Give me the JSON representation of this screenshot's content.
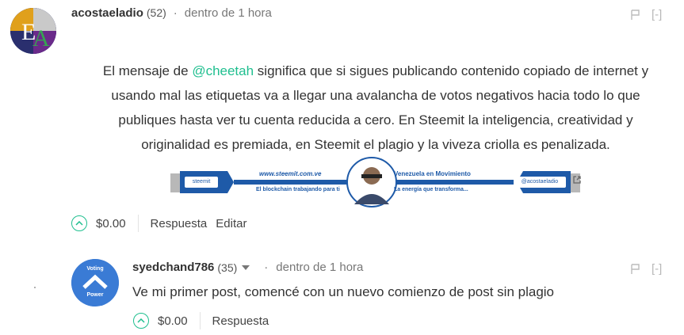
{
  "comment1": {
    "author": "acostaeladio",
    "reputation": "(52)",
    "separator": "·",
    "time": "dentro de 1 hora",
    "collapse_label": "[-]",
    "body": {
      "line1_pre": "El mensaje de ",
      "mention": "@cheetah",
      "line1_post": " significa que si sigues publicando contenido copiado de internet y",
      "line2": "usando mal las etiquetas va a llegar una avalancha de votos negativos hacia todo lo que",
      "line3": "publiques hasta ver tu cuenta reducida a cero. En Steemit la inteligencia, creatividad y",
      "line4": "originalidad es premiada, en Steemit el plagio y la viveza criolla es penalizada."
    },
    "banner": {
      "left_tag": "steemit",
      "url": "www.steemit.com.ve",
      "tagline_left": "El blockchain trabajando para ti",
      "title_right": "Venezuela en Movimiento",
      "tagline_right": "La energía que transforma...",
      "right_tag": "@acostaeladio"
    },
    "payout": "$0.00",
    "reply_label": "Respuesta",
    "edit_label": "Editar"
  },
  "comment2": {
    "author": "syedchand786",
    "reputation": "(35)",
    "separator": "·",
    "time": "dentro de 1 hora",
    "collapse_label": "[-]",
    "avatar_text_top": "Voting",
    "avatar_text_bottom": "Power",
    "body": "Ve mi primer post, comencé con un nuevo comienzo de post sin plagio",
    "payout": "$0.00",
    "reply_label": "Respuesta"
  },
  "colors": {
    "accent": "#1fbf8f",
    "banner_blue": "#1e5aa8"
  }
}
